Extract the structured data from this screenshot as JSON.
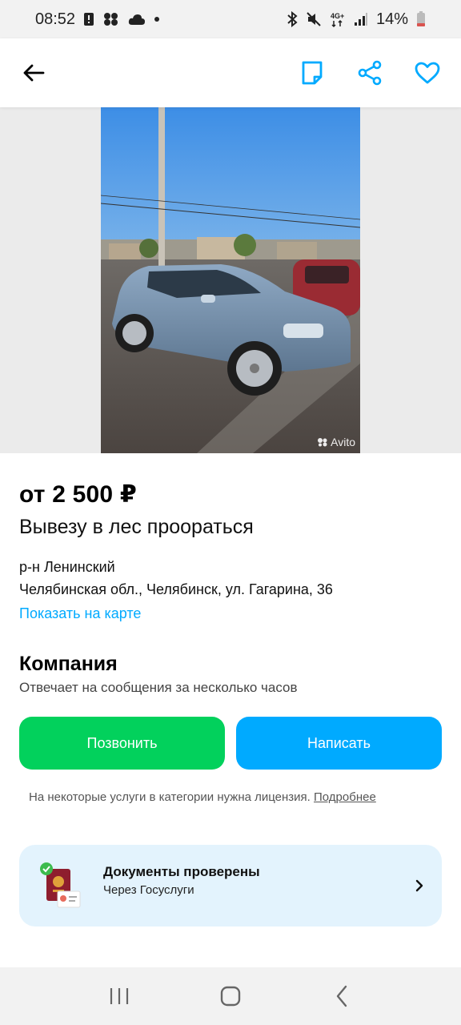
{
  "status_bar": {
    "time": "08:52",
    "battery": "14%",
    "icons": [
      "alert-icon",
      "apps-icon",
      "cloud-icon",
      "dot-icon",
      "bluetooth-icon",
      "mute-icon",
      "4g-icon",
      "signal-icon",
      "battery-icon"
    ]
  },
  "app_bar": {
    "back_icon": "arrow-left-icon",
    "actions": [
      "note-icon",
      "share-icon",
      "heart-icon"
    ],
    "accent": "#00aaff"
  },
  "gallery": {
    "watermark": "Avito"
  },
  "listing": {
    "price": "от 2 500 ₽",
    "title": "Вывезу в лес проораться",
    "district": "р-н Ленинский",
    "address": "Челябинская обл., Челябинск, ул. Гагарина, 36",
    "map_link": "Показать на карте"
  },
  "seller": {
    "name": "Компания",
    "response_time": "Отвечает на сообщения за несколько часов"
  },
  "buttons": {
    "call": "Позвонить",
    "write": "Написать",
    "call_color": "#02d15c",
    "write_color": "#00aaff"
  },
  "license": {
    "text": "На некоторые услуги в категории нужна лицензия.",
    "more": "Подробнее"
  },
  "documents": {
    "title": "Документы проверены",
    "subtitle": "Через Госуслуги"
  }
}
